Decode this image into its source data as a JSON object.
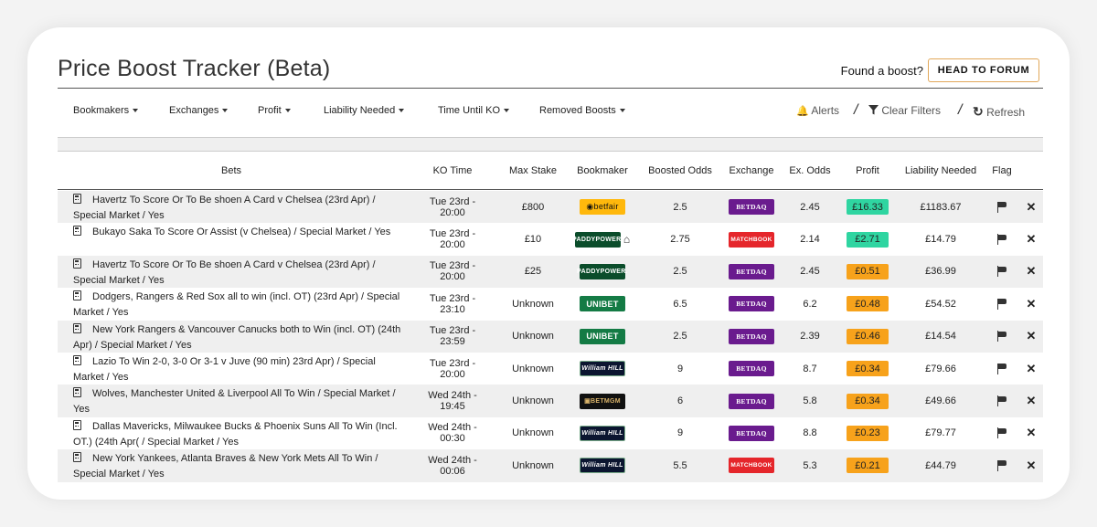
{
  "header": {
    "title": "Price Boost Tracker (Beta)",
    "found_text": "Found a boost?",
    "forum_button": "HEAD TO FORUM"
  },
  "filters": {
    "bookmakers": "Bookmakers",
    "exchanges": "Exchanges",
    "profit": "Profit",
    "liability": "Liability Needed",
    "time_until_ko": "Time Until KO",
    "removed": "Removed Boosts",
    "alerts": "Alerts",
    "clear": "Clear Filters",
    "refresh": "Refresh"
  },
  "table": {
    "columns": [
      "Bets",
      "KO Time",
      "Max Stake",
      "Bookmaker",
      "Boosted Odds",
      "Exchange",
      "Ex. Odds",
      "Profit",
      "Liability Needed",
      "Flag"
    ],
    "rows": [
      {
        "bet": "Havertz To Score Or To Be shoen A Card v Chelsea (23rd Apr) / Special Market / Yes",
        "ko": "Tue 23rd - 20:00",
        "stake": "£800",
        "bookmaker": "betfair",
        "bookmaker_label": "◉betfair",
        "boosted": "2.5",
        "exchange": "betdaq",
        "exchange_label": "BETDAQ",
        "ex_odds": "2.45",
        "profit": "£16.33",
        "profit_color": "#2fd5a1",
        "liability": "£1183.67"
      },
      {
        "bet": "Bukayo Saka To Score Or Assist (v Chelsea) / Special Market / Yes",
        "ko": "Tue 23rd - 20:00",
        "stake": "£10",
        "bookmaker": "paddy",
        "bookmaker_label": "PADDYPOWER.",
        "home": "⌂",
        "boosted": "2.75",
        "exchange": "matchbook",
        "exchange_label": "MATCHBOOK",
        "ex_odds": "2.14",
        "profit": "£2.71",
        "profit_color": "#2fd5a1",
        "liability": "£14.79"
      },
      {
        "bet": "Havertz To Score Or To Be shoen A Card v Chelsea (23rd Apr) / Special Market / Yes",
        "ko": "Tue 23rd - 20:00",
        "stake": "£25",
        "bookmaker": "paddy",
        "bookmaker_label": "PADDYPOWER.",
        "boosted": "2.5",
        "exchange": "betdaq",
        "exchange_label": "BETDAQ",
        "ex_odds": "2.45",
        "profit": "£0.51",
        "profit_color": "#f7a21b",
        "liability": "£36.99"
      },
      {
        "bet": "Dodgers, Rangers & Red Sox all to win (incl. OT) (23rd Apr) / Special Market / Yes",
        "ko": "Tue 23rd - 23:10",
        "stake": "Unknown",
        "bookmaker": "unibet",
        "bookmaker_label": "UNIBET",
        "boosted": "6.5",
        "exchange": "betdaq",
        "exchange_label": "BETDAQ",
        "ex_odds": "6.2",
        "profit": "£0.48",
        "profit_color": "#f7a21b",
        "liability": "£54.52"
      },
      {
        "bet": "New York Rangers & Vancouver Canucks both to Win (incl. OT) (24th Apr) / Special Market / Yes",
        "ko": "Tue 23rd - 23:59",
        "stake": "Unknown",
        "bookmaker": "unibet",
        "bookmaker_label": "UNIBET",
        "boosted": "2.5",
        "exchange": "betdaq",
        "exchange_label": "BETDAQ",
        "ex_odds": "2.39",
        "profit": "£0.46",
        "profit_color": "#f7a21b",
        "liability": "£14.54"
      },
      {
        "bet": "Lazio To Win 2-0, 3-0 Or 3-1 v Juve (90 min) 23rd Apr) / Special Market / Yes",
        "ko": "Tue 23rd - 20:00",
        "stake": "Unknown",
        "bookmaker": "hill",
        "bookmaker_label": "William HILL",
        "boosted": "9",
        "exchange": "betdaq",
        "exchange_label": "BETDAQ",
        "ex_odds": "8.7",
        "profit": "£0.34",
        "profit_color": "#f7a21b",
        "liability": "£79.66"
      },
      {
        "bet": "Wolves, Manchester United & Liverpool All To Win / Special Market / Yes",
        "ko": "Wed 24th - 19:45",
        "stake": "Unknown",
        "bookmaker": "betmgm",
        "bookmaker_label": "▣BETMGM",
        "boosted": "6",
        "exchange": "betdaq",
        "exchange_label": "BETDAQ",
        "ex_odds": "5.8",
        "profit": "£0.34",
        "profit_color": "#f7a21b",
        "liability": "£49.66"
      },
      {
        "bet": "Dallas Mavericks, Milwaukee Bucks & Phoenix Suns All To Win (Incl. OT.) (24th Apr( / Special Market / Yes",
        "ko": "Wed 24th - 00:30",
        "stake": "Unknown",
        "bookmaker": "hill",
        "bookmaker_label": "William HILL",
        "boosted": "9",
        "exchange": "betdaq",
        "exchange_label": "BETDAQ",
        "ex_odds": "8.8",
        "profit": "£0.23",
        "profit_color": "#f7a21b",
        "liability": "£79.77"
      },
      {
        "bet": "New York Yankees, Atlanta Braves & New York Mets All To Win / Special Market / Yes",
        "ko": "Wed 24th - 00:06",
        "stake": "Unknown",
        "bookmaker": "hill",
        "bookmaker_label": "William HILL",
        "boosted": "5.5",
        "exchange": "matchbook",
        "exchange_label": "MATCHBOOK",
        "ex_odds": "5.3",
        "profit": "£0.21",
        "profit_color": "#f7a21b",
        "liability": "£44.79"
      }
    ]
  },
  "icons": {
    "calculator": "calculator-icon",
    "flag": "flag-icon",
    "remove": "✕",
    "bell": "🔔",
    "filter": "▼",
    "refresh": "↻"
  }
}
